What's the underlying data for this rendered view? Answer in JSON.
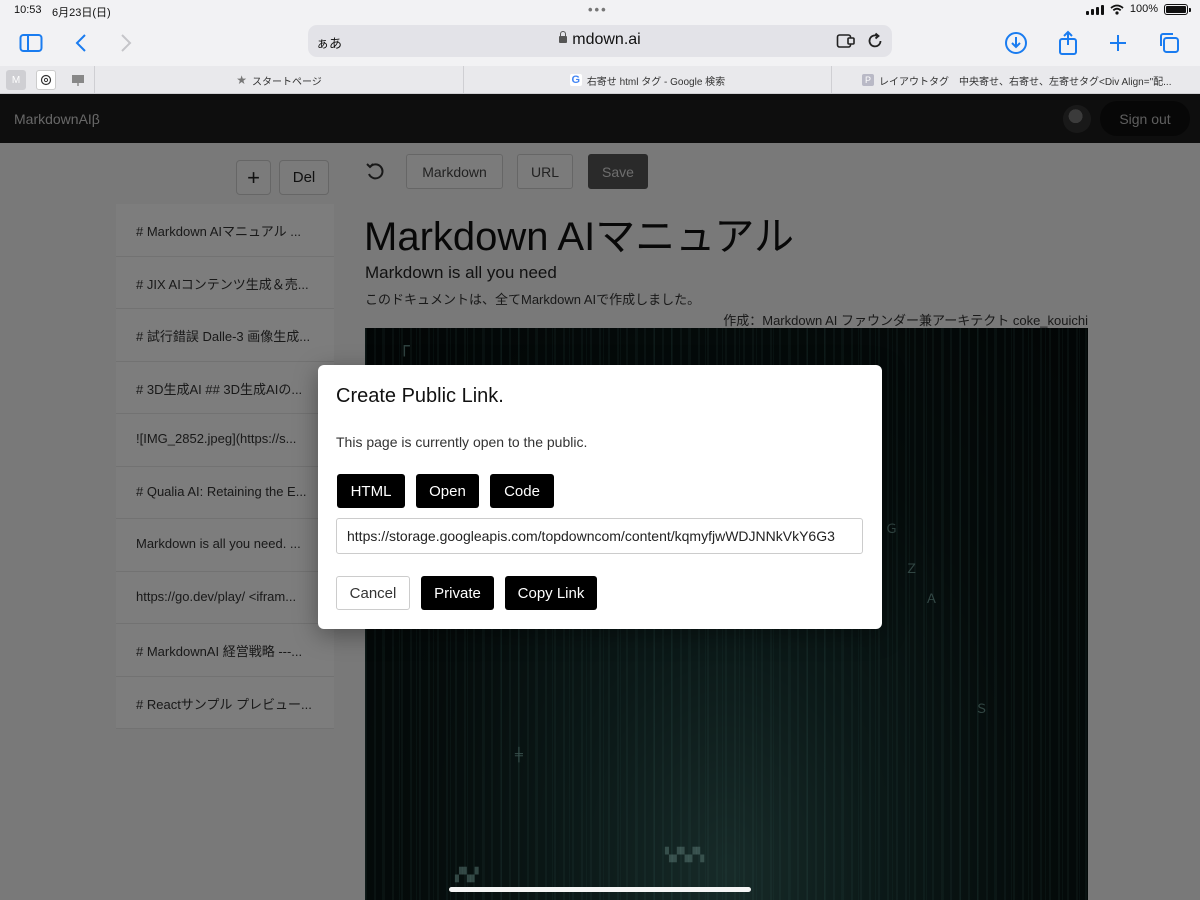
{
  "status": {
    "time": "10:53",
    "date": "6月23日(日)",
    "battery": "100%"
  },
  "browser": {
    "address_prefix": "ぁあ",
    "url": "mdown.ai",
    "pinned": [
      "M",
      "",
      ""
    ],
    "tabs": [
      {
        "label": "スタートページ"
      },
      {
        "label": "右寄せ html タグ - Google 検索"
      },
      {
        "label": "レイアウトタグ　中央寄せ、右寄せ、左寄せタグ<Div Align=\"配..."
      }
    ]
  },
  "app": {
    "brand": "MarkdownAIβ",
    "signout": "Sign out"
  },
  "sidebar": {
    "add": "+",
    "delete": "Del",
    "items": [
      "# Markdown AIマニュアル ...",
      "# JIX AIコンテンツ生成＆売...",
      "# 試行錯誤 Dalle-3 画像生成...",
      "# 3D生成AI ## 3D生成AIの...",
      "![IMG_2852.jpeg](https://s...",
      "# Qualia AI: Retaining the E...",
      "Markdown is all you need. ...",
      "https://go.dev/play/ <ifram...",
      "# MarkdownAI 経営戦略 ---...",
      "# Reactサンプル プレビュー..."
    ]
  },
  "editor": {
    "markdown": "Markdown",
    "url": "URL",
    "save": "Save",
    "title": "Markdown AIマニュアル",
    "subtitle": "Markdown is all you need",
    "description": "このドキュメントは、全てMarkdown AIで作成しました。",
    "author": "作成：Markdown AI ファウンダー兼アーキテクト coke_kouichi"
  },
  "modal": {
    "title": "Create Public Link.",
    "text": "This page is currently open to the public.",
    "html": "HTML",
    "open": "Open",
    "code": "Code",
    "link": "https://storage.googleapis.com/topdowncom/content/kqmyfjwWDJNNkVkY6G3",
    "cancel": "Cancel",
    "private": "Private",
    "copy": "Copy Link"
  }
}
